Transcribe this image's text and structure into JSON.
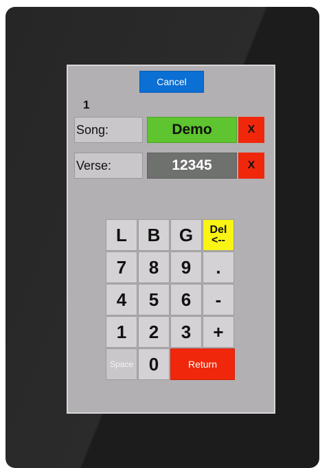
{
  "header": {
    "cancel_label": "Cancel"
  },
  "index_label": "1",
  "song": {
    "label": "Song:",
    "value": "Demo",
    "clear_label": "X"
  },
  "verse": {
    "label": "Verse:",
    "value": "12345",
    "clear_label": "X"
  },
  "keypad": {
    "row1": [
      "L",
      "B",
      "G"
    ],
    "del_line1": "Del",
    "del_line2": "<--",
    "row2": [
      "7",
      "8",
      "9",
      "."
    ],
    "row3": [
      "4",
      "5",
      "6",
      "-"
    ],
    "row4": [
      "1",
      "2",
      "3",
      "+"
    ],
    "space_label": "Space",
    "zero_label": "0",
    "return_label": "Return"
  },
  "colors": {
    "cancel": "#0b6fd4",
    "song_value_bg": "#5ec42f",
    "verse_value_bg": "#6f716f",
    "clear": "#f0270b",
    "del_key": "#f9f414",
    "return_key": "#f0270b",
    "screen_bg": "#b2b0b2",
    "bezel": "#262626"
  }
}
